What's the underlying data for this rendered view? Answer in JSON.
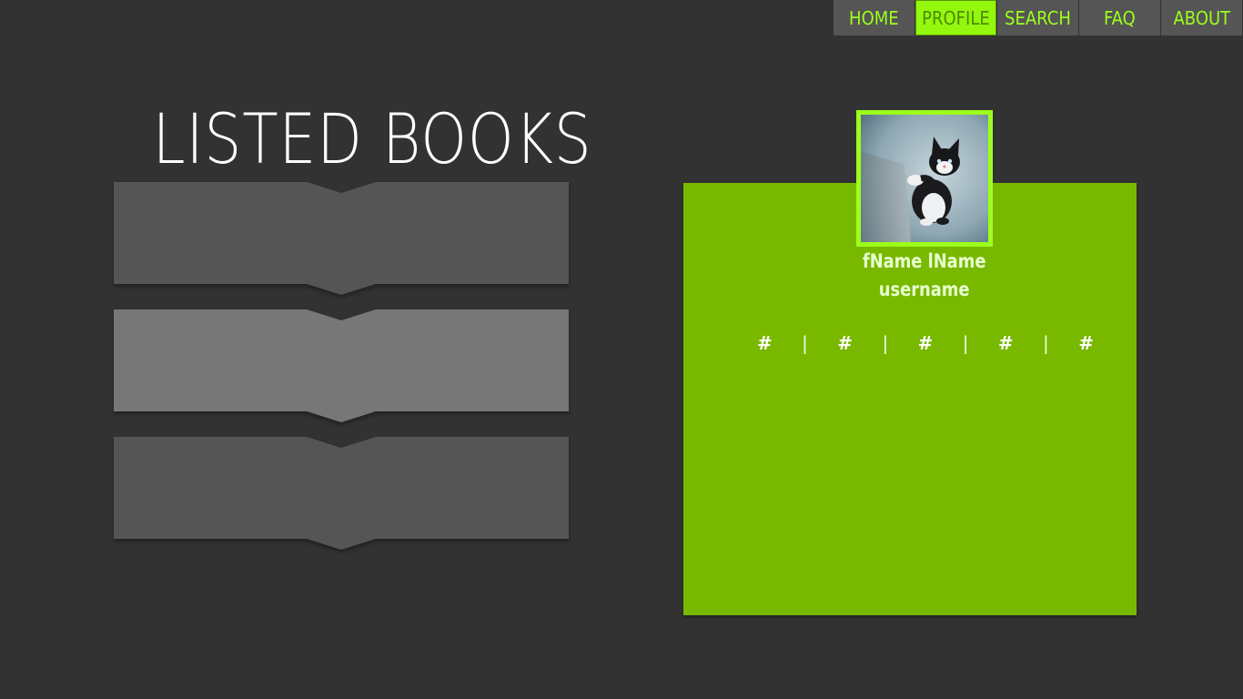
{
  "nav": {
    "items": [
      {
        "label": "HOME",
        "active": false
      },
      {
        "label": "PROFILE",
        "active": true
      },
      {
        "label": "SEARCH",
        "active": false
      },
      {
        "label": "FAQ",
        "active": false
      },
      {
        "label": "ABOUT",
        "active": false
      }
    ]
  },
  "books": {
    "title": "LISTED BOOKS",
    "items": [
      {
        "color": "#555555"
      },
      {
        "color": "#777777"
      },
      {
        "color": "#555555"
      }
    ]
  },
  "profile": {
    "fullname": "fName lName",
    "username": "username",
    "stats": [
      "#",
      "#",
      "#",
      "#",
      "#"
    ],
    "separator": "|",
    "avatar_icon": "kitten-photo"
  },
  "colors": {
    "accent": "#9cff1c",
    "card": "#78b900",
    "background": "#323232",
    "nav_bg": "#555555"
  }
}
